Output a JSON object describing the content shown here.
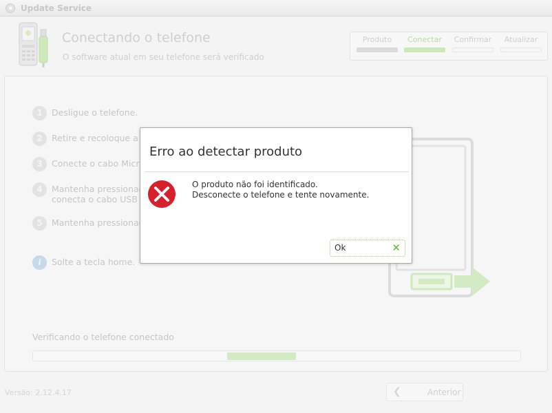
{
  "window": {
    "title": "Update Service"
  },
  "header": {
    "title": "Conectando o telefone",
    "subtitle": "O software atual em seu telefone será verificado"
  },
  "steps": [
    {
      "label": "Produto",
      "state": "done"
    },
    {
      "label": "Conectar",
      "state": "active"
    },
    {
      "label": "Confirmar",
      "state": "pending"
    },
    {
      "label": "Atualizar",
      "state": "pending"
    }
  ],
  "instructions": [
    {
      "num": "1",
      "text": "Desligue o telefone."
    },
    {
      "num": "2",
      "text": "Retire e recoloque a b"
    },
    {
      "num": "3",
      "text": "Conecte o cabo Micro"
    },
    {
      "num": "4",
      "text": "Mantenha pressionada",
      "text2": "conecta o cabo USB a"
    },
    {
      "num": "5",
      "text": "Mantenha pressionada"
    },
    {
      "num": "i",
      "text": "Solte a tecla home."
    }
  ],
  "progress": {
    "label": "Verificando o telefone conectado",
    "value": 0.14
  },
  "footer": {
    "version": "Versão: 2.12.4.17",
    "back_label": "Anterior"
  },
  "dialog": {
    "title": "Erro ao detectar produto",
    "line1": "O produto não foi identificado.",
    "line2": "Desconecte o telefone e tente novamente.",
    "ok_label": "Ok"
  },
  "colors": {
    "accent_green": "#6ab43a",
    "error_red": "#d8202c"
  }
}
